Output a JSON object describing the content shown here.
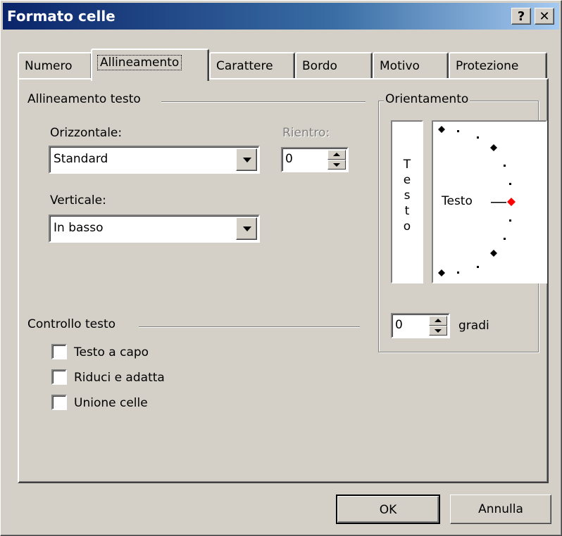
{
  "window": {
    "title": "Formato celle",
    "help_label": "?",
    "close_label": "✕"
  },
  "tabs": [
    {
      "label": "Numero",
      "active": false
    },
    {
      "label": "Allineamento",
      "active": true
    },
    {
      "label": "Carattere",
      "active": false
    },
    {
      "label": "Bordo",
      "active": false
    },
    {
      "label": "Motivo",
      "active": false
    },
    {
      "label": "Protezione",
      "active": false
    }
  ],
  "alignment": {
    "group_label": "Allineamento testo",
    "horizontal_label": "Orizzontale:",
    "horizontal_value": "Standard",
    "indent_label": "Rientro:",
    "indent_value": "0",
    "vertical_label": "Verticale:",
    "vertical_value": "In basso"
  },
  "text_control": {
    "group_label": "Controllo testo",
    "wrap_text": {
      "label": "Testo a capo",
      "checked": false
    },
    "shrink_to_fit": {
      "label": "Riduci e adatta",
      "checked": false
    },
    "merge_cells": {
      "label": "Unione celle",
      "checked": false
    }
  },
  "orientation": {
    "group_label": "Orientamento",
    "vertical_text": "T\ne\ns\nt\no",
    "dial_text": "Testo",
    "degrees_value": "0",
    "degrees_label": "gradi",
    "marker_color": "#ff0000"
  },
  "buttons": {
    "ok": "OK",
    "cancel": "Annulla"
  }
}
